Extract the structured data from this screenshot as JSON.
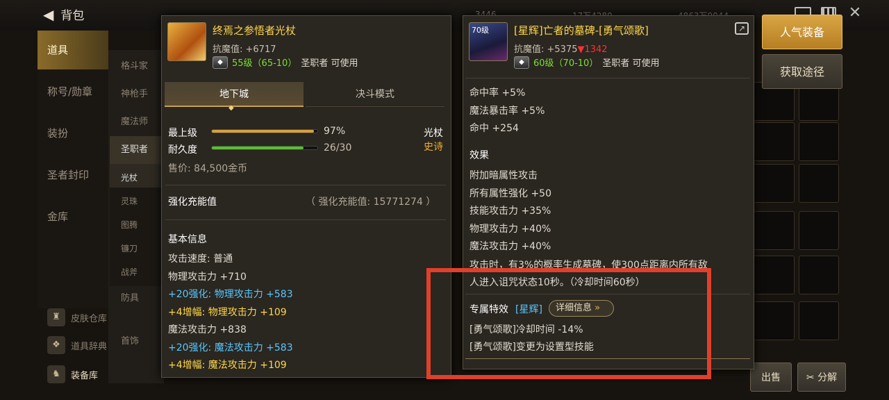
{
  "topbar": {
    "back_label": "背包",
    "gold_left": "3446",
    "gold_mid": "17万4280",
    "gold_right": "4863万9044"
  },
  "left_nav": [
    "道具",
    "称号/勋章",
    "装扮",
    "圣者封印",
    "金库"
  ],
  "sub_nav": [
    "格斗家",
    "神枪手",
    "魔法师",
    "圣职者",
    "光杖",
    "灵珠",
    "图腾",
    "镰刀",
    "战斧",
    "防具",
    "首饰"
  ],
  "side_tools": [
    "皮肤仓库",
    "道具辞典",
    "装备库"
  ],
  "right_buttons": {
    "popular": "人气装备",
    "source": "获取途径",
    "sell": "出售",
    "disassemble": "分解"
  },
  "left_item": {
    "name": "终焉之参悟者光杖",
    "stat_label": "抗魔值: ",
    "stat_value": "+6717",
    "level": "55级（65-10）",
    "usable": "圣职者 可使用",
    "tabs": [
      "地下城",
      "决斗模式"
    ],
    "grade_label": "最上级",
    "grade_pct": "97%",
    "grade_fill": 0.97,
    "durability_label": "耐久度",
    "durability": "26/30",
    "durability_fill": 0.8667,
    "type": "光杖",
    "rarity": "史诗",
    "price": "售价: 84,500金币",
    "charge_label": "强化充能值",
    "charge_value": "（ 强化充能值: 15771274 ）",
    "basic_title": "基本信息",
    "lines": [
      {
        "text": "攻击速度: 普通",
        "color": "white"
      },
      {
        "text": "物理攻击力 +710",
        "color": "white"
      },
      {
        "text": "+20强化: 物理攻击力 +583",
        "color": "cyan"
      },
      {
        "text": " +4增幅: 物理攻击力 +109",
        "color": "yellow"
      },
      {
        "text": "魔法攻击力 +838",
        "color": "white"
      },
      {
        "text": "+20强化: 魔法攻击力 +583",
        "color": "cyan"
      },
      {
        "text": " +4增幅: 魔法攻击力 +109",
        "color": "yellow"
      }
    ]
  },
  "right_item": {
    "icon_level": "70级",
    "name": "[星辉]亡者的墓碑-[勇气颂歌]",
    "stat_label": "抗魔值: ",
    "stat_value": "+5375",
    "stat_diff": "▼1342",
    "level": "60级（70-10）",
    "usable": "圣职者 可使用",
    "lines_top": [
      "命中率 +5%",
      "魔法暴击率 +5%",
      "命中 +254"
    ],
    "effect_title": "效果",
    "effects": [
      "附加暗属性攻击",
      "所有属性强化 +50",
      "技能攻击力 +35%",
      "物理攻击力 +40%",
      "魔法攻击力 +40%"
    ],
    "proc_line1": "攻击时，有3%的概率生成墓碑，使300点距离内所有敌",
    "proc_line2": "人进入诅咒状态10秒。（冷却时间60秒）",
    "special_title": "专属特效",
    "special_tag": "[星辉]",
    "detail_btn": "详细信息",
    "special_lines": [
      "[勇气颂歌]冷却时间 -14%",
      "[勇气颂歌]变更为设置型技能"
    ]
  },
  "colors": {
    "highlight_box": "#e0402a",
    "item_name": "#ffd84a",
    "enhance": "#58c8ff",
    "amplify": "#ffd84a",
    "level_green": "#78e030",
    "down_red": "#ff3030"
  }
}
